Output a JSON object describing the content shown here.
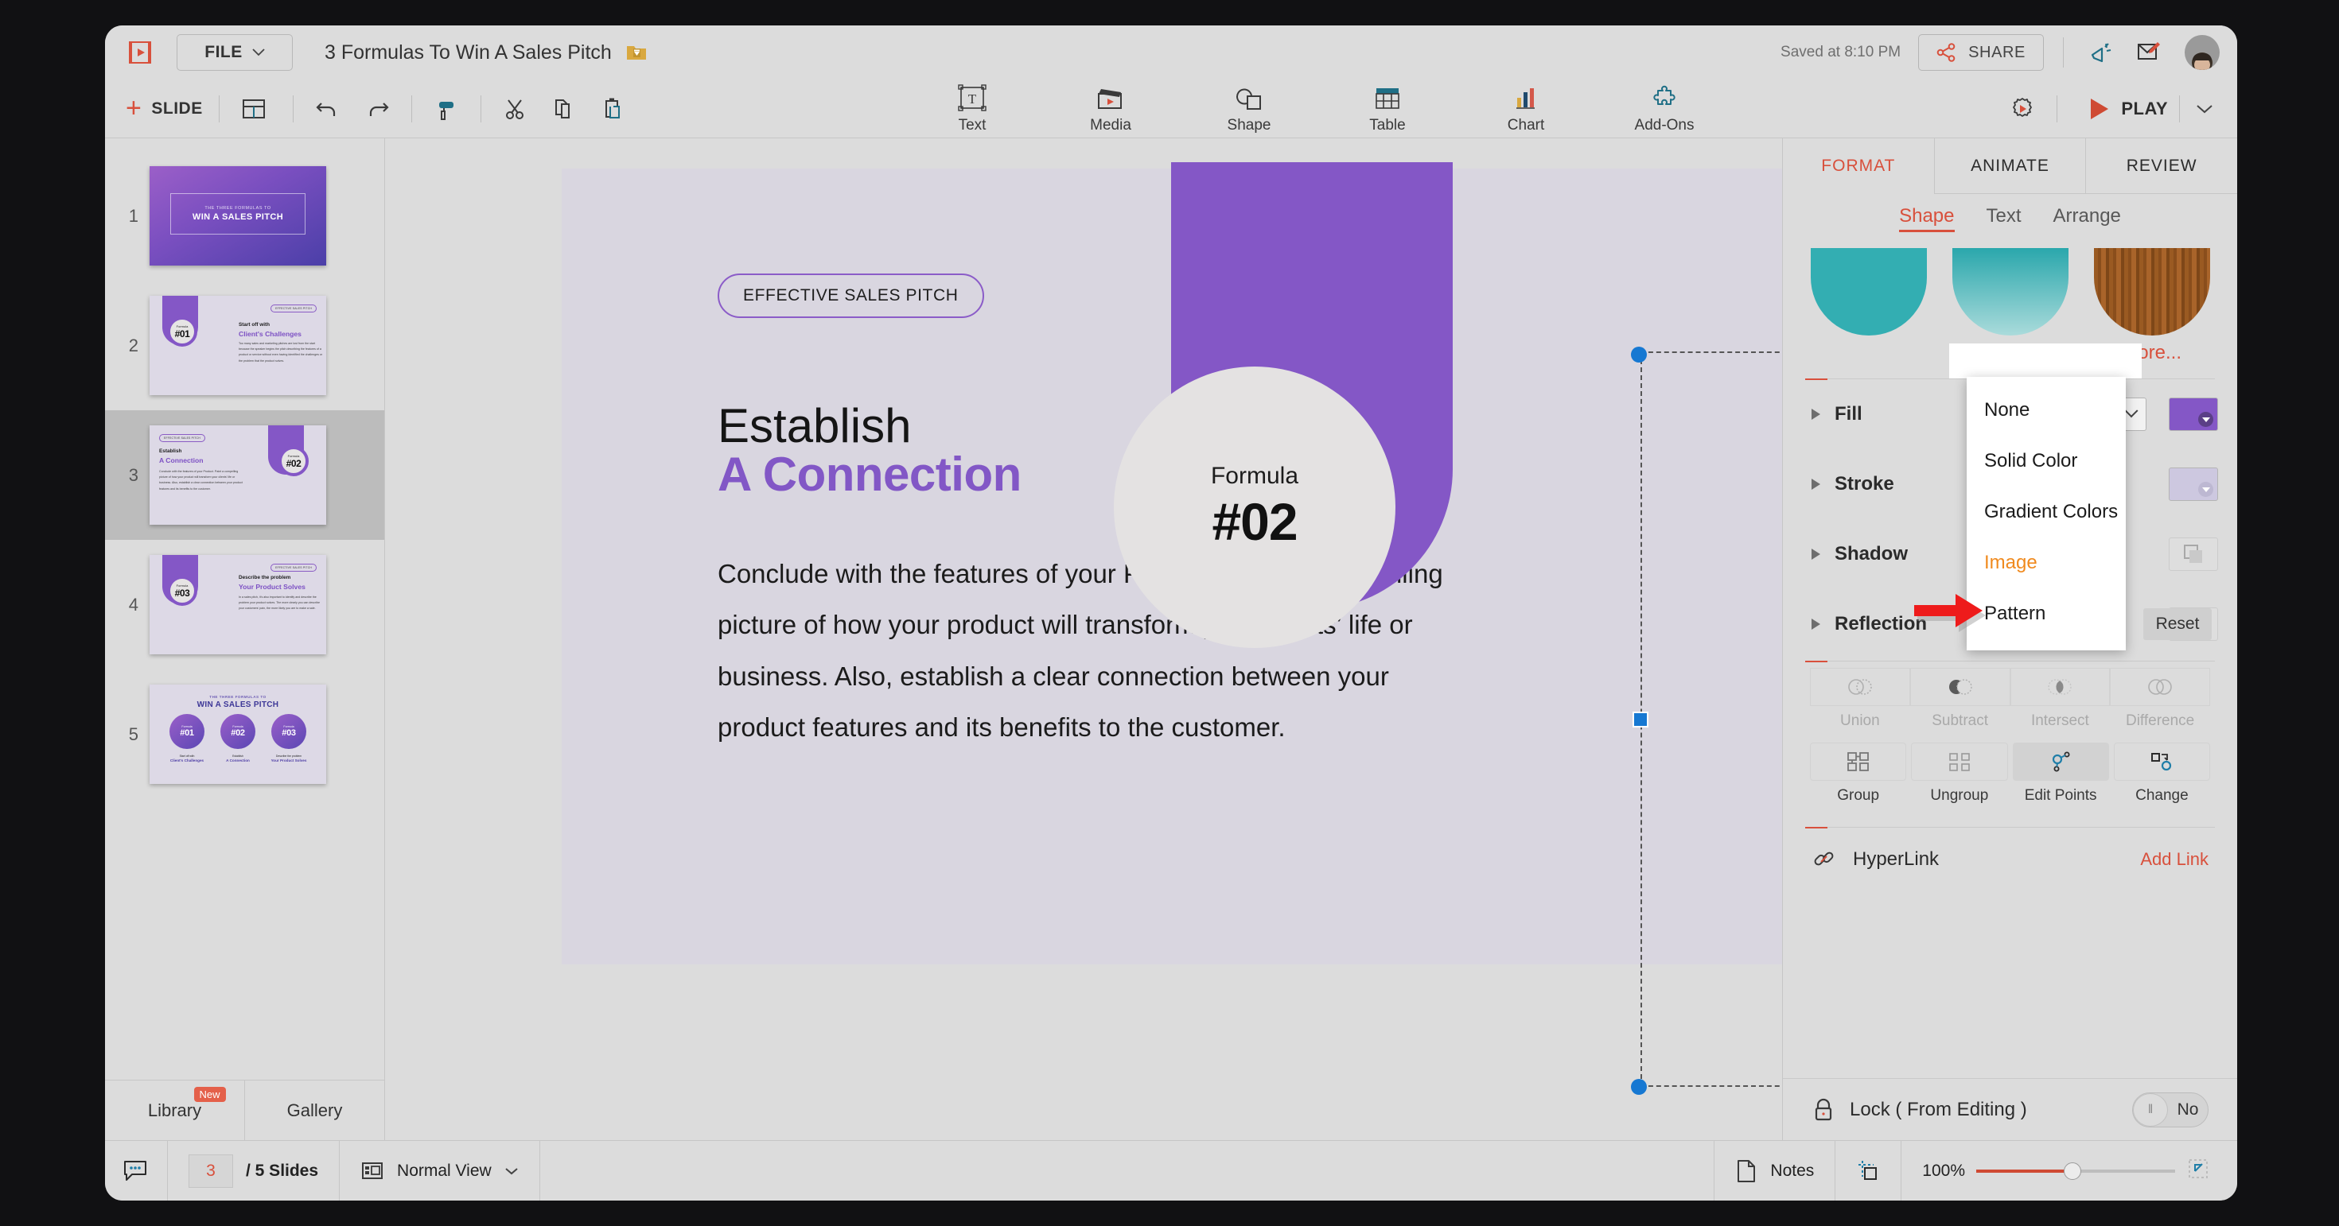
{
  "topbar": {
    "logo_icon": "presentation-logo-icon",
    "file_label": "FILE",
    "doc_title": "3 Formulas To Win A Sales Pitch",
    "folder_icon": "folder-download-icon",
    "saved_text": "Saved at 8:10 PM",
    "share_label": "SHARE",
    "share_icon": "share-nodes-icon",
    "announce_icon": "megaphone-icon",
    "feedback_icon": "compose-icon"
  },
  "toolbar": {
    "slide_label": "SLIDE",
    "layout_icon": "layout-icon",
    "undo_icon": "undo-icon",
    "redo_icon": "redo-icon",
    "paint_icon": "paint-roller-icon",
    "cut_icon": "scissors-icon",
    "copy_icon": "copy-icon",
    "paste_icon": "paste-icon",
    "tools": [
      {
        "label": "Text",
        "icon": "text-box-icon"
      },
      {
        "label": "Media",
        "icon": "clapperboard-icon"
      },
      {
        "label": "Shape",
        "icon": "shapes-icon"
      },
      {
        "label": "Table",
        "icon": "table-icon"
      },
      {
        "label": "Chart",
        "icon": "bar-chart-icon"
      },
      {
        "label": "Add-Ons",
        "icon": "puzzle-piece-icon"
      }
    ],
    "settings_icon": "gear-play-icon",
    "play_label": "PLAY",
    "play_caret_icon": "chevron-down-icon"
  },
  "slides_panel": {
    "slides": [
      {
        "number": "1",
        "subtitle": "THE THREE FORMULAS TO",
        "title": "WIN A SALES PITCH"
      },
      {
        "number": "2",
        "pill": "EFFECTIVE SALES PITCH",
        "cap": "Start off with",
        "title": "Client's Challenges",
        "body": "Too many sales and marketing pitches are lost from the start because the speaker begins the pitch describing the features of a product or service without even having identified the challenges or the problem that the product solves.",
        "formula_label": "Formula",
        "formula_num": "#01"
      },
      {
        "number": "3",
        "pill": "EFFECTIVE SALES PITCH",
        "cap": "Establish",
        "title": "A Connection",
        "body": "Conclude with the features of your Product. Paint a compelling picture of how your product will transform your clients' life or business. Also, establish a clear connection between your product features and its benefits to the customer.",
        "formula_label": "Formula",
        "formula_num": "#02"
      },
      {
        "number": "4",
        "pill": "EFFECTIVE SALES PITCH",
        "cap": "Describe the problem",
        "title": "Your Product Solves",
        "body": "In a sales pitch, it's also important to identify and describe the problem your product solves. The more clearly you can describe your customers' pain, the more likely you are to make a sale.",
        "formula_label": "Formula",
        "formula_num": "#03"
      },
      {
        "number": "5",
        "subtitle": "THE THREE FORMULAS TO",
        "title": "WIN A SALES PITCH",
        "circles": [
          {
            "formula_label": "Formula",
            "formula_num": "#01",
            "cap": "Start off with",
            "title": "Client's Challenges"
          },
          {
            "formula_label": "Formula",
            "formula_num": "#02",
            "cap": "Establish",
            "title": "A Connection"
          },
          {
            "formula_label": "Formula",
            "formula_num": "#03",
            "cap": "Describe the problem",
            "title": "Your Product Solves"
          }
        ]
      }
    ],
    "active_slide": "3",
    "library_tab": "Library",
    "library_badge": "New",
    "gallery_tab": "Gallery"
  },
  "canvas": {
    "pill": "EFFECTIVE SALES PITCH",
    "heading_line1": "Establish",
    "heading_line2": "A Connection",
    "paragraph": "Conclude with the features of your Product. Paint a compelling picture of how your product will transform your clients’ life or business. Also, establish a clear connection between your product features and its benefits to the customer.",
    "formula_label": "Formula",
    "formula_number": "#02",
    "shape_color": "#8457c6",
    "circle_color": "#e4e2e2"
  },
  "format_panel": {
    "tabs": [
      {
        "label": "FORMAT",
        "active": true
      },
      {
        "label": "ANIMATE",
        "active": false
      },
      {
        "label": "REVIEW",
        "active": false
      }
    ],
    "subtabs": [
      {
        "label": "Shape",
        "active": true
      },
      {
        "label": "Text",
        "active": false
      },
      {
        "label": "Arrange",
        "active": false
      }
    ],
    "gallery": [
      {
        "name": "teal-solid-shape",
        "color": "#33aeb2"
      },
      {
        "name": "teal-gradient-shape",
        "color": "#2aa7ac"
      },
      {
        "name": "wood-texture-shape",
        "color": "#9a5a22"
      }
    ],
    "more_label": "More...",
    "properties": [
      {
        "label": "Fill",
        "value": "Solid Color",
        "swatch": "#8457c6"
      },
      {
        "label": "Stroke",
        "value": "",
        "swatch": "#cdc8e0"
      },
      {
        "label": "Shadow",
        "value": "",
        "swatch": ""
      },
      {
        "label": "Reflection",
        "value": "",
        "swatch": ""
      }
    ],
    "reset_label": "Reset",
    "fill_dropdown": {
      "selected": "Solid Color",
      "open": true,
      "highlighted": "Image",
      "options": [
        "None",
        "Solid Color",
        "Gradient Colors",
        "Image",
        "Pattern"
      ]
    },
    "boolean_ops": [
      {
        "label": "Union",
        "icon": "union-icon",
        "enabled": false
      },
      {
        "label": "Subtract",
        "icon": "subtract-icon",
        "enabled": false
      },
      {
        "label": "Intersect",
        "icon": "intersect-icon",
        "enabled": false
      },
      {
        "label": "Difference",
        "icon": "difference-icon",
        "enabled": false
      }
    ],
    "group_ops": [
      {
        "label": "Group",
        "icon": "group-icon",
        "enabled": true
      },
      {
        "label": "Ungroup",
        "icon": "ungroup-icon",
        "enabled": true
      },
      {
        "label": "Edit Points",
        "icon": "edit-points-icon",
        "enabled": true
      },
      {
        "label": "Change",
        "icon": "change-shape-icon",
        "enabled": true
      }
    ],
    "hyperlink_label": "HyperLink",
    "hyperlink_icon": "link-icon",
    "add_link_label": "Add Link",
    "lock_label": "Lock ( From Editing )",
    "lock_icon": "lock-icon",
    "lock_value": "No"
  },
  "statusbar": {
    "comment_icon": "comment-icon",
    "current_page": "3",
    "total_pages": "/ 5 Slides",
    "view_icon": "normal-view-icon",
    "view_label": "Normal View",
    "notes_icon": "notes-page-icon",
    "notes_label": "Notes",
    "fit_icon": "fit-to-screen-icon",
    "zoom_level": "100%",
    "expand_icon": "expand-icon"
  },
  "colors": {
    "accent_red": "#d8503c",
    "purple": "#8457c6",
    "highlight_orange": "#f08a1e",
    "teal": "#33aeb2"
  }
}
